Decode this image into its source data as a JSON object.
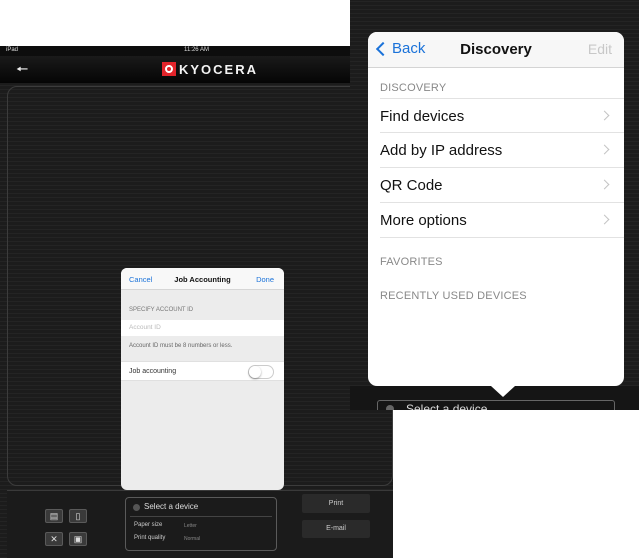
{
  "left_screen": {
    "status_bar": {
      "carrier": "iPad",
      "time": "11:26 AM"
    },
    "logo_text": "KYOCERA",
    "job_accounting": {
      "cancel_label": "Cancel",
      "title": "Job Accounting",
      "done_label": "Done",
      "section_header": "SPECIFY ACCOUNT ID",
      "account_placeholder": "Account ID",
      "hint": "Account ID must be 8 numbers or less.",
      "toggle_label": "Job accounting",
      "toggle_on": false
    },
    "bottom_bar": {
      "device_label": "Select a device",
      "settings": [
        {
          "label": "Paper size",
          "value": "Letter"
        },
        {
          "label": "Print quality",
          "value": "Normal"
        }
      ],
      "print_label": "Print",
      "email_label": "E-mail"
    }
  },
  "discovery": {
    "back_label": "Back",
    "title": "Discovery",
    "edit_label": "Edit",
    "sections": [
      {
        "header": "DISCOVERY",
        "items": [
          "Find devices",
          "Add by IP address",
          "QR Code",
          "More options"
        ]
      },
      {
        "header": "FAVORITES",
        "items": []
      },
      {
        "header": "RECENTLY USED DEVICES",
        "items": []
      }
    ],
    "device_label": "Select a device"
  }
}
